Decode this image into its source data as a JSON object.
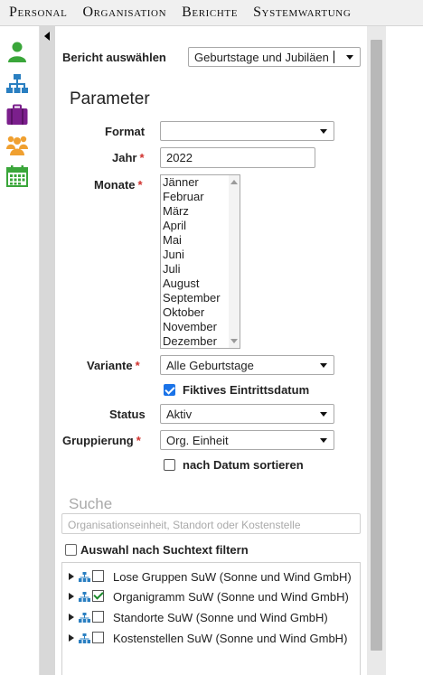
{
  "menu": [
    "Personal",
    "Organisation",
    "Berichte",
    "Systemwartung"
  ],
  "nav_icons": [
    "person-icon",
    "org-chart-icon",
    "briefcase-icon",
    "group-icon",
    "calendar-icon"
  ],
  "report": {
    "label": "Bericht auswählen",
    "value": "Geburtstage und Jubiläen"
  },
  "params": {
    "heading": "Parameter",
    "format_label": "Format",
    "format_value": "",
    "jahr_label": "Jahr",
    "jahr_value": "2022",
    "monate_label": "Monate",
    "months": [
      "Jänner",
      "Februar",
      "März",
      "April",
      "Mai",
      "Juni",
      "Juli",
      "August",
      "September",
      "Oktober",
      "November",
      "Dezember"
    ],
    "variante_label": "Variante",
    "variante_value": "Alle Geburtstage",
    "fiktiv_label": "Fiktives Eintrittsdatum",
    "fiktiv_checked": true,
    "status_label": "Status",
    "status_value": "Aktiv",
    "gruppierung_label": "Gruppierung",
    "gruppierung_value": "Org. Einheit",
    "datum_label": "nach Datum sortieren",
    "datum_checked": false,
    "required_mark": "*"
  },
  "search": {
    "heading": "Suche",
    "placeholder": "Organisationseinheit, Standort oder Kostenstelle",
    "filter_label": "Auswahl nach Suchtext filtern"
  },
  "tree": [
    {
      "label": "Lose Gruppen SuW (Sonne und Wind GmbH)",
      "checked": false
    },
    {
      "label": "Organigramm SuW (Sonne und Wind GmbH)",
      "checked": true
    },
    {
      "label": "Standorte SuW (Sonne und Wind GmbH)",
      "checked": false
    },
    {
      "label": "Kostenstellen SuW (Sonne und Wind GmbH)",
      "checked": false
    }
  ],
  "colors": {
    "accent": "#1a73e8",
    "required": "#d0312d",
    "person": "#3aa63a",
    "org": "#2a7fc1",
    "briefcase": "#7b1f8c",
    "group": "#f0a030",
    "calendar": "#3aa63a"
  }
}
